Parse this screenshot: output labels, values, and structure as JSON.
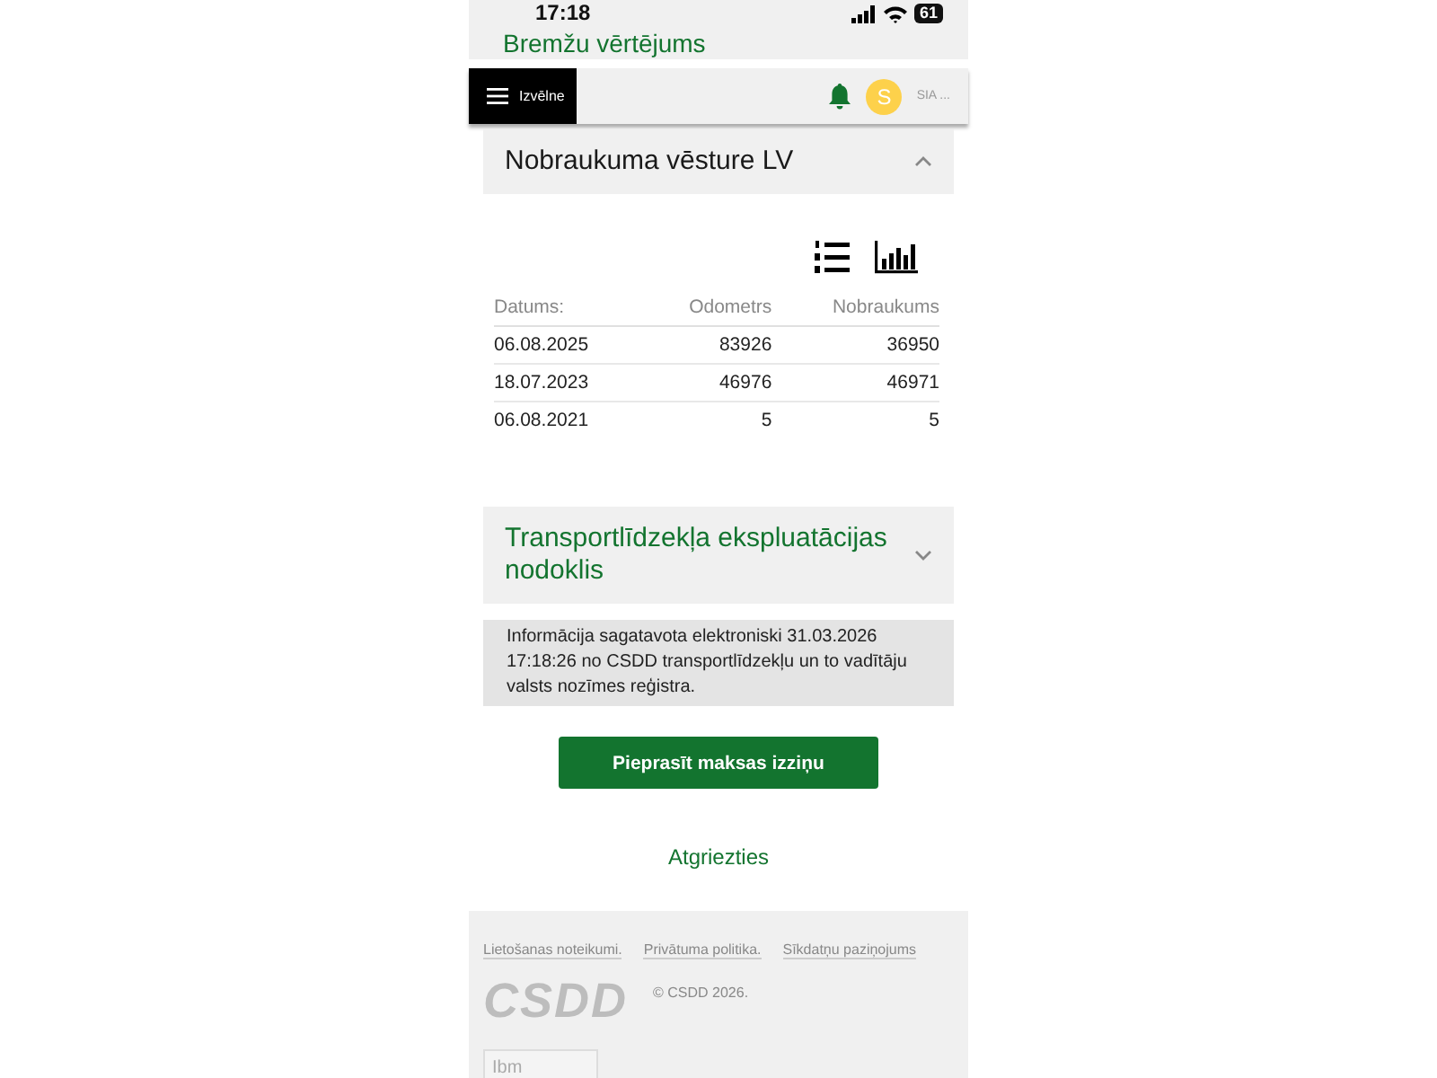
{
  "status_bar": {
    "time": "17:18",
    "battery": "61"
  },
  "top_section": {
    "title": "Bremžu vērtējums"
  },
  "header": {
    "menu_label": "Izvēlne",
    "avatar_letter": "S",
    "account": "SIA ..."
  },
  "sections": [
    {
      "title": "Nobraukuma vēsture LV",
      "expanded": true,
      "kind": "table",
      "table": {
        "columns": [
          "Datums:",
          "Odometrs",
          "Nobraukums"
        ],
        "rows": [
          [
            "06.08.2025",
            "83926",
            "36950"
          ],
          [
            "18.07.2023",
            "46976",
            "46971"
          ],
          [
            "06.08.2021",
            "5",
            "5"
          ]
        ]
      }
    },
    {
      "title": "Transportlīdzekļa ekspluatācijas nodoklis",
      "expanded": false,
      "kind": "plain"
    }
  ],
  "info": "Informācija sagatavota elektroniski 31.03.2026 17:18:26 no CSDD transportlīdzekļu un to vadītāju valsts nozīmes reģistra.",
  "primary_button": "Pieprasīt maksas izziņu",
  "back_link": "Atgriezties",
  "footer": {
    "links": [
      "Lietošanas noteikumi.",
      "Privātuma politika.",
      "Sīkdatņu paziņojums"
    ],
    "logo": "CSDD",
    "copyright": "© CSDD 2026.",
    "field_value": "Ibm"
  }
}
